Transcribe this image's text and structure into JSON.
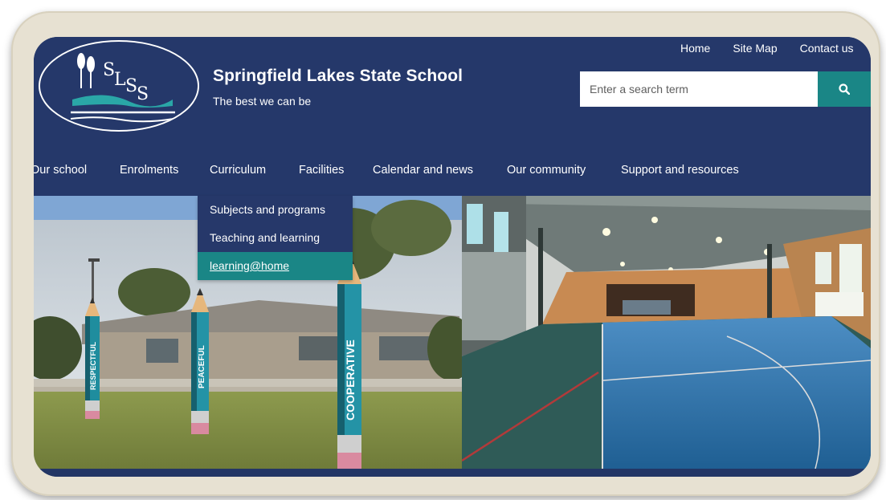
{
  "site": {
    "name": "Springfield Lakes State School",
    "motto": "The best we can be",
    "logo_text": "SLSS"
  },
  "utility_nav": [
    {
      "label": "Home"
    },
    {
      "label": "Site Map"
    },
    {
      "label": "Contact us"
    }
  ],
  "search": {
    "placeholder": "Enter a search term",
    "icon": "search-icon"
  },
  "main_nav": [
    {
      "label": "Our school"
    },
    {
      "label": "Enrolments"
    },
    {
      "label": "Curriculum"
    },
    {
      "label": "Facilities"
    },
    {
      "label": "Calendar and news"
    },
    {
      "label": "Our community"
    },
    {
      "label": "Support and resources"
    }
  ],
  "dropdown": {
    "parent": "Curriculum",
    "items": [
      {
        "label": "Subjects and programs",
        "active": false
      },
      {
        "label": "Teaching and learning",
        "active": false
      },
      {
        "label": "learning@home",
        "active": true
      }
    ]
  },
  "hero": {
    "pencils": [
      {
        "word": "RESPECTFUL"
      },
      {
        "word": "PEACEFUL"
      },
      {
        "word": "COOPERATIVE"
      }
    ]
  },
  "colors": {
    "header_bg": "#25386a",
    "accent_teal": "#1a8686",
    "frame": "#e7e1d2"
  }
}
